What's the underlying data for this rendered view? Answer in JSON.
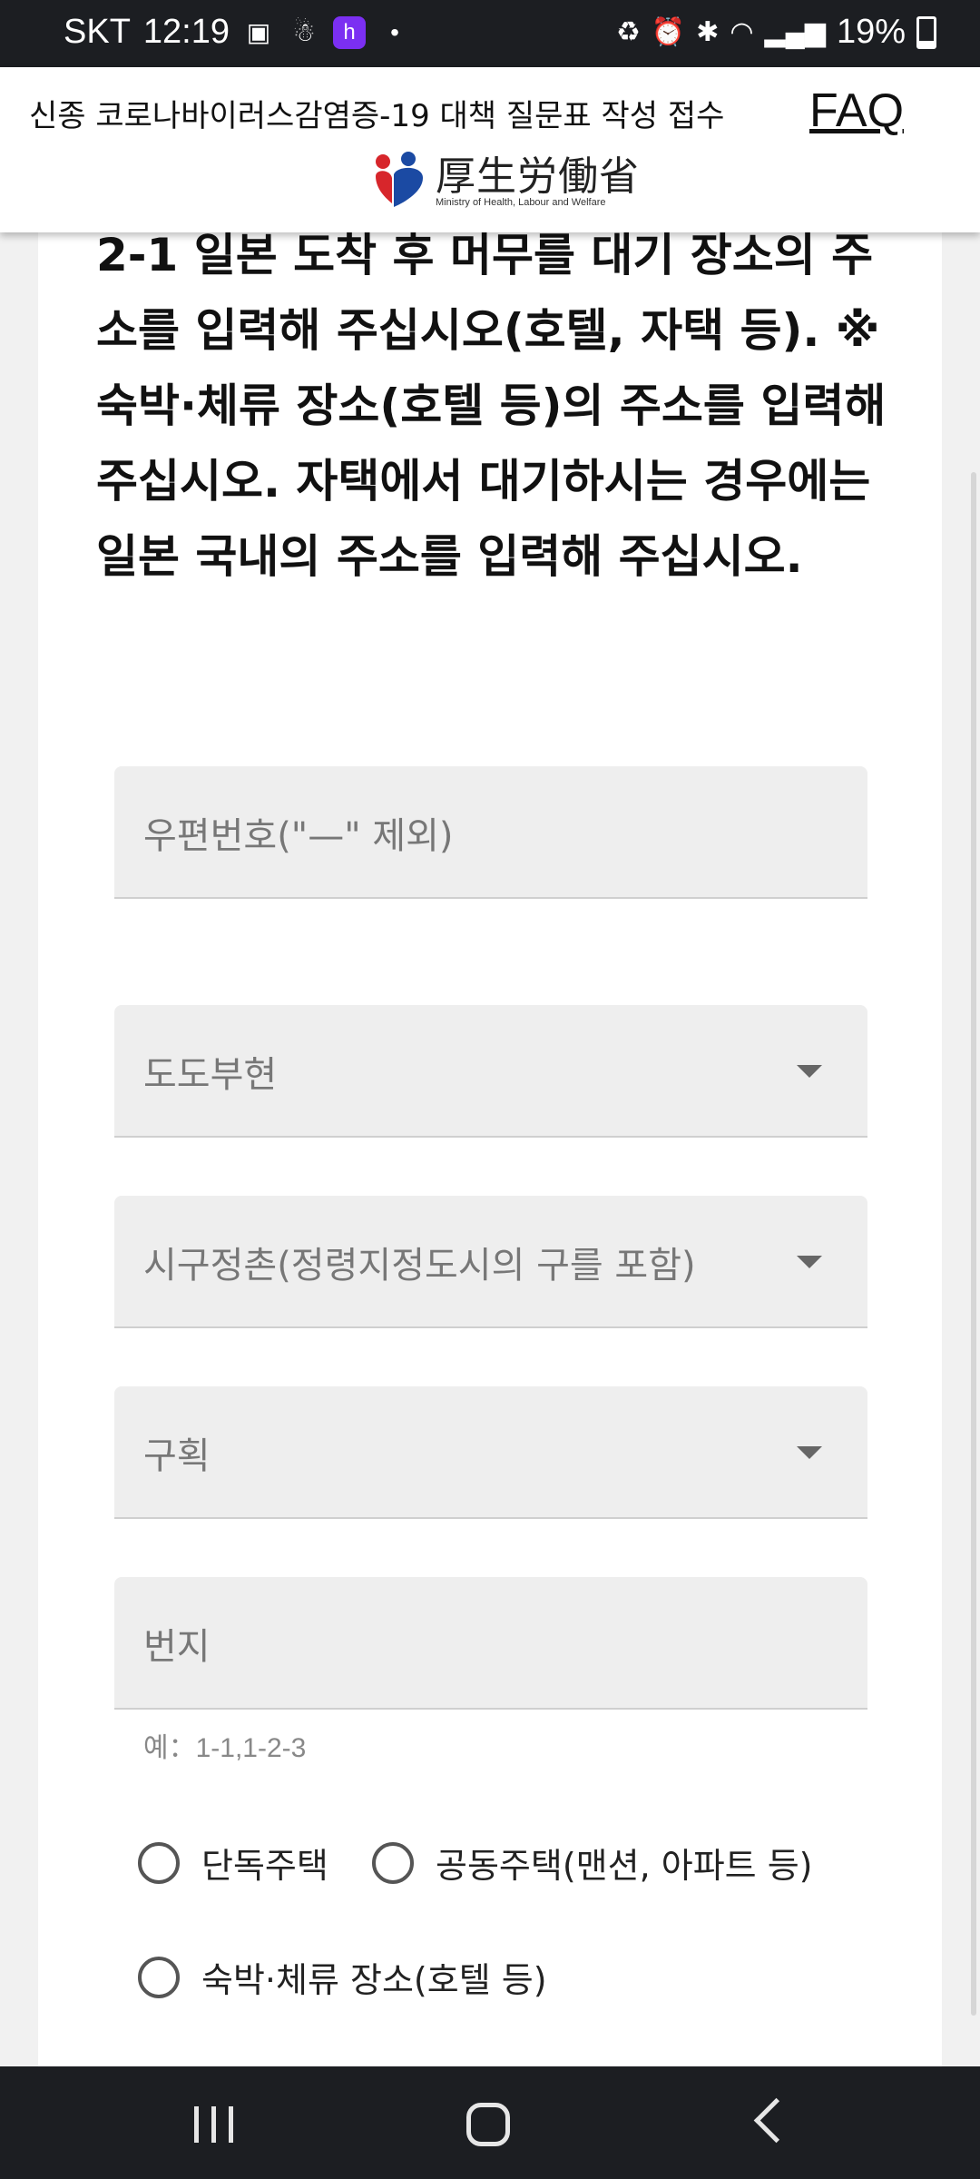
{
  "status_bar": {
    "carrier": "SKT",
    "time": "12:19",
    "battery_percent": "19%",
    "left_icons": [
      "image-icon",
      "person-icon",
      "app-badge-icon",
      "dot-icon"
    ],
    "right_icons": [
      "recycle-icon",
      "alarm-icon",
      "bluetooth-icon",
      "wifi-icon",
      "signal-icon",
      "battery-icon"
    ]
  },
  "header": {
    "title": "신종 코로나바이러스감염증-19 대책 질문표 작성 접수",
    "faq": "FAQ",
    "logo_jp": "厚生労働省",
    "logo_en": "Ministry of Health, Labour and Welfare"
  },
  "question": {
    "text": "2-1  일본 도착 후 머무를 대기 장소의 주소를 입력해 주십시오(호텔, 자택 등). ※숙박·체류 장소(호텔 등)의 주소를 입력해 주십시오. 자택에서 대기하시는 경우에는 일본 국내의 주소를 입력해 주십시오."
  },
  "form": {
    "postal_code_placeholder": "우편번호(\"—\" 제외)",
    "prefecture_placeholder": "도도부현",
    "city_placeholder": "시구정촌(정령지정도시의 구를 포함)",
    "district_placeholder": "구획",
    "address_placeholder": "번지",
    "address_hint": "예：1-1,1-2-3",
    "housing_options": [
      "단독주택",
      "공동주택(맨션, 아파트 등)",
      "숙박·체류 장소(호텔 등)"
    ]
  },
  "nav": {
    "icons": [
      "recent-apps-icon",
      "home-icon",
      "back-icon"
    ]
  }
}
